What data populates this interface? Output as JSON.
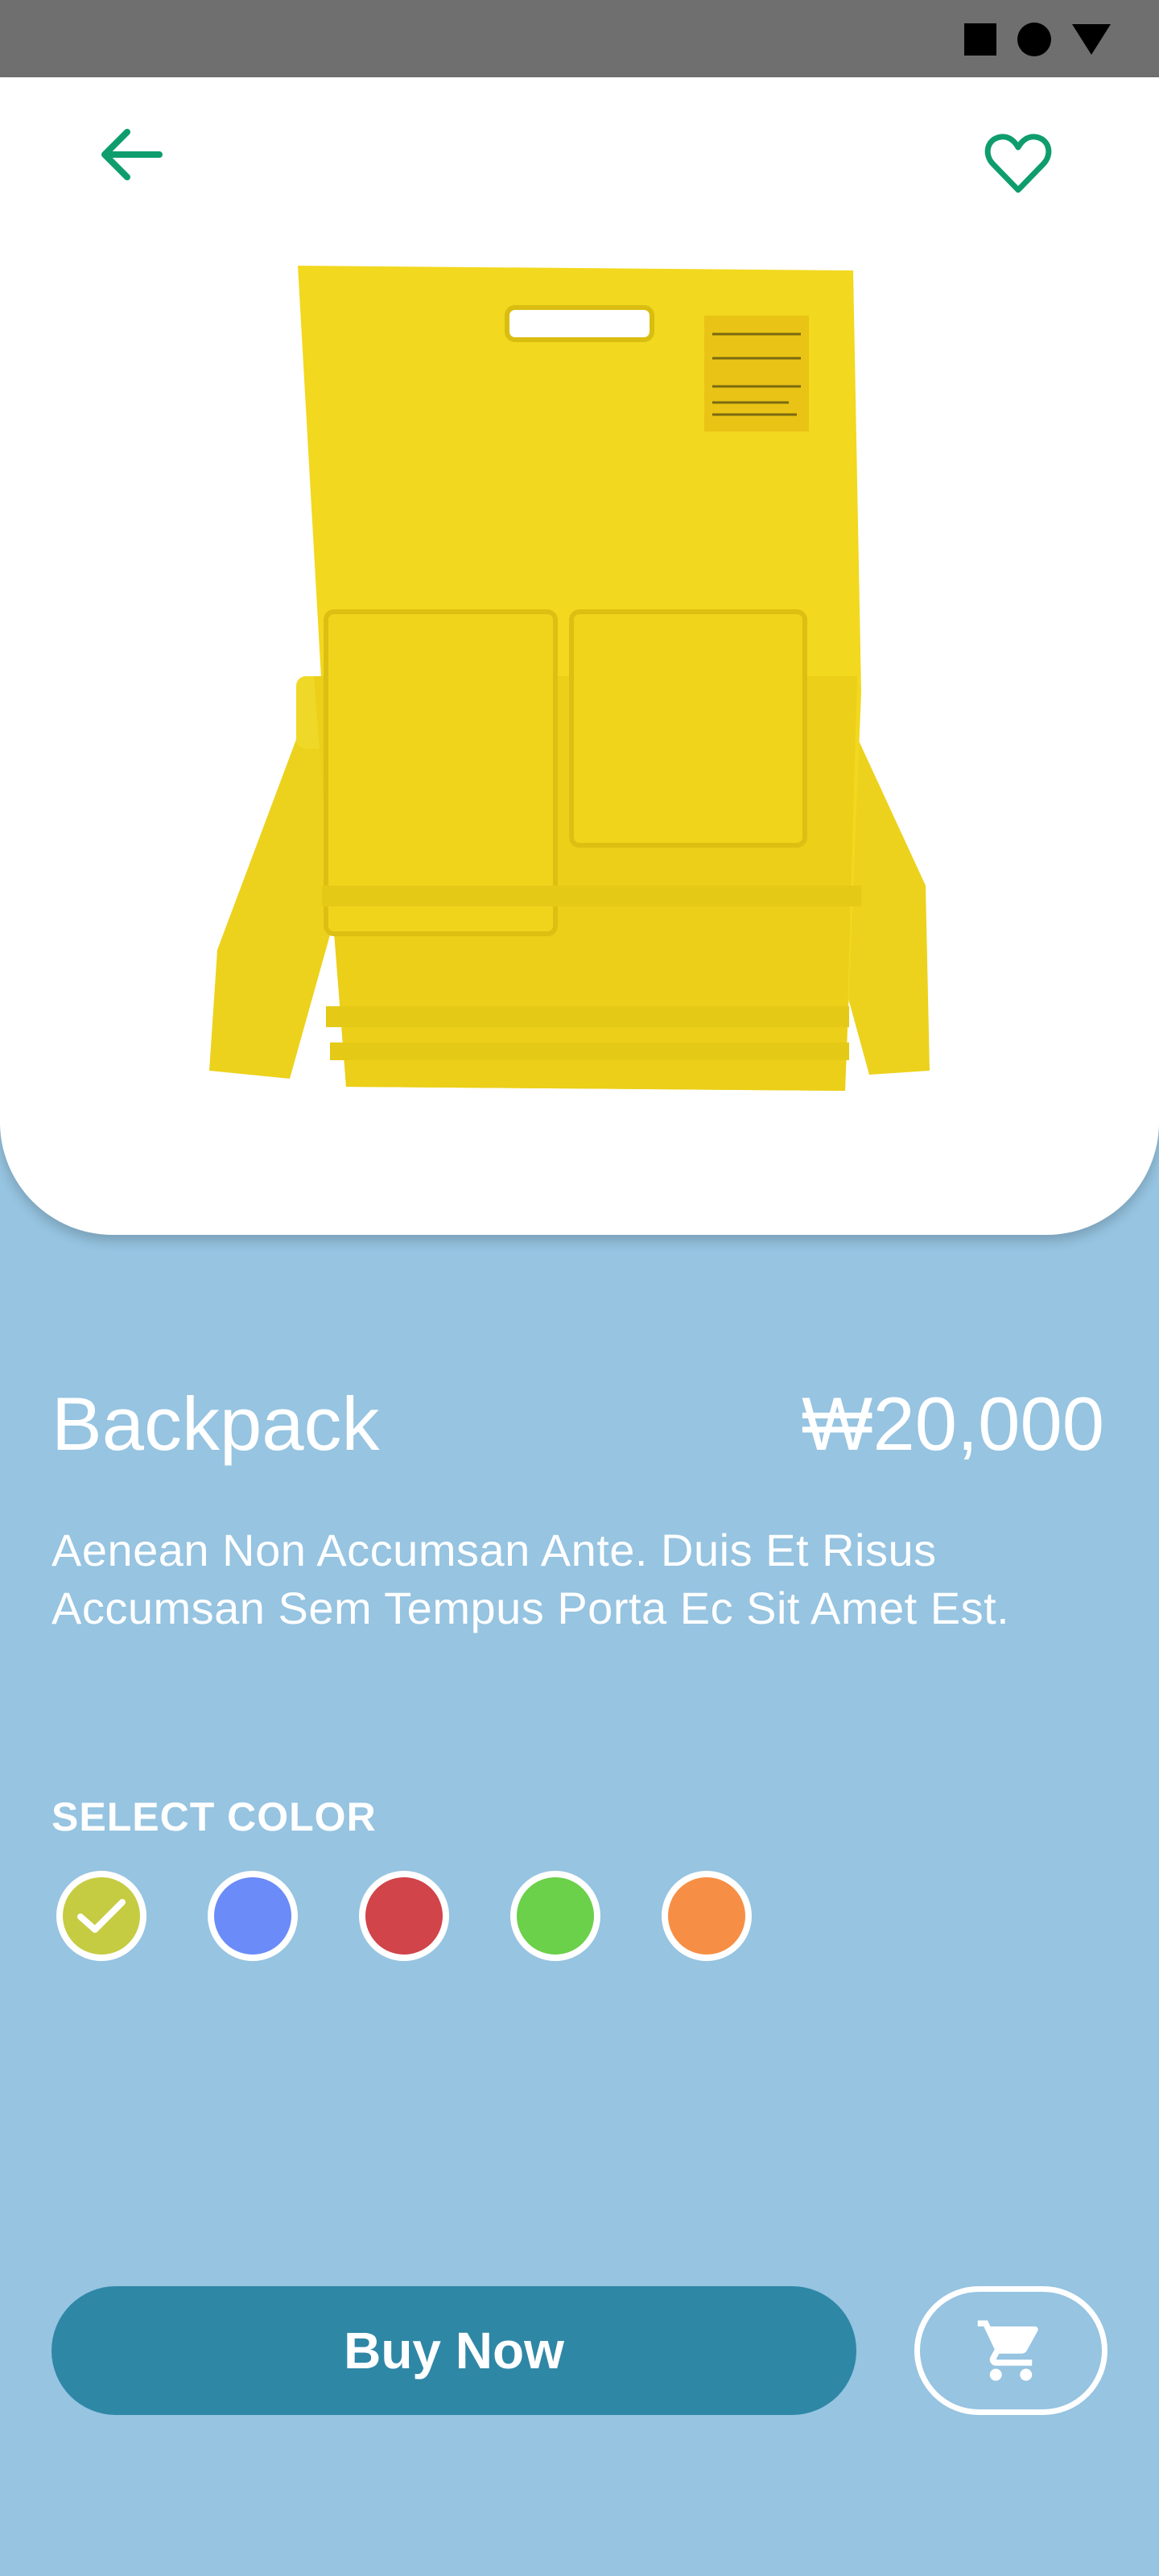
{
  "product": {
    "name": "Backpack",
    "price": "₩20,000",
    "description": "Aenean Non Accumsan Ante. Duis Et Risus Accumsan Sem Tempus Porta Ec Sit Amet Est."
  },
  "colors": {
    "label": "SELECT COLOR",
    "options": [
      {
        "name": "olive-yellow",
        "hex": "#c5cc42",
        "selected": true
      },
      {
        "name": "blue",
        "hex": "#6a8bf8",
        "selected": false
      },
      {
        "name": "red",
        "hex": "#d1444a",
        "selected": false
      },
      {
        "name": "green",
        "hex": "#6bd04a",
        "selected": false
      },
      {
        "name": "orange",
        "hex": "#f68f45",
        "selected": false
      }
    ]
  },
  "actions": {
    "buy_label": "Buy Now"
  },
  "theme": {
    "background": "#96c4e1",
    "accent": "#2f87a6",
    "icon_green": "#0f9d6e",
    "bag_yellow": "#f2d81e"
  },
  "icons": [
    "back-arrow-icon",
    "heart-icon",
    "cart-icon",
    "check-icon"
  ]
}
